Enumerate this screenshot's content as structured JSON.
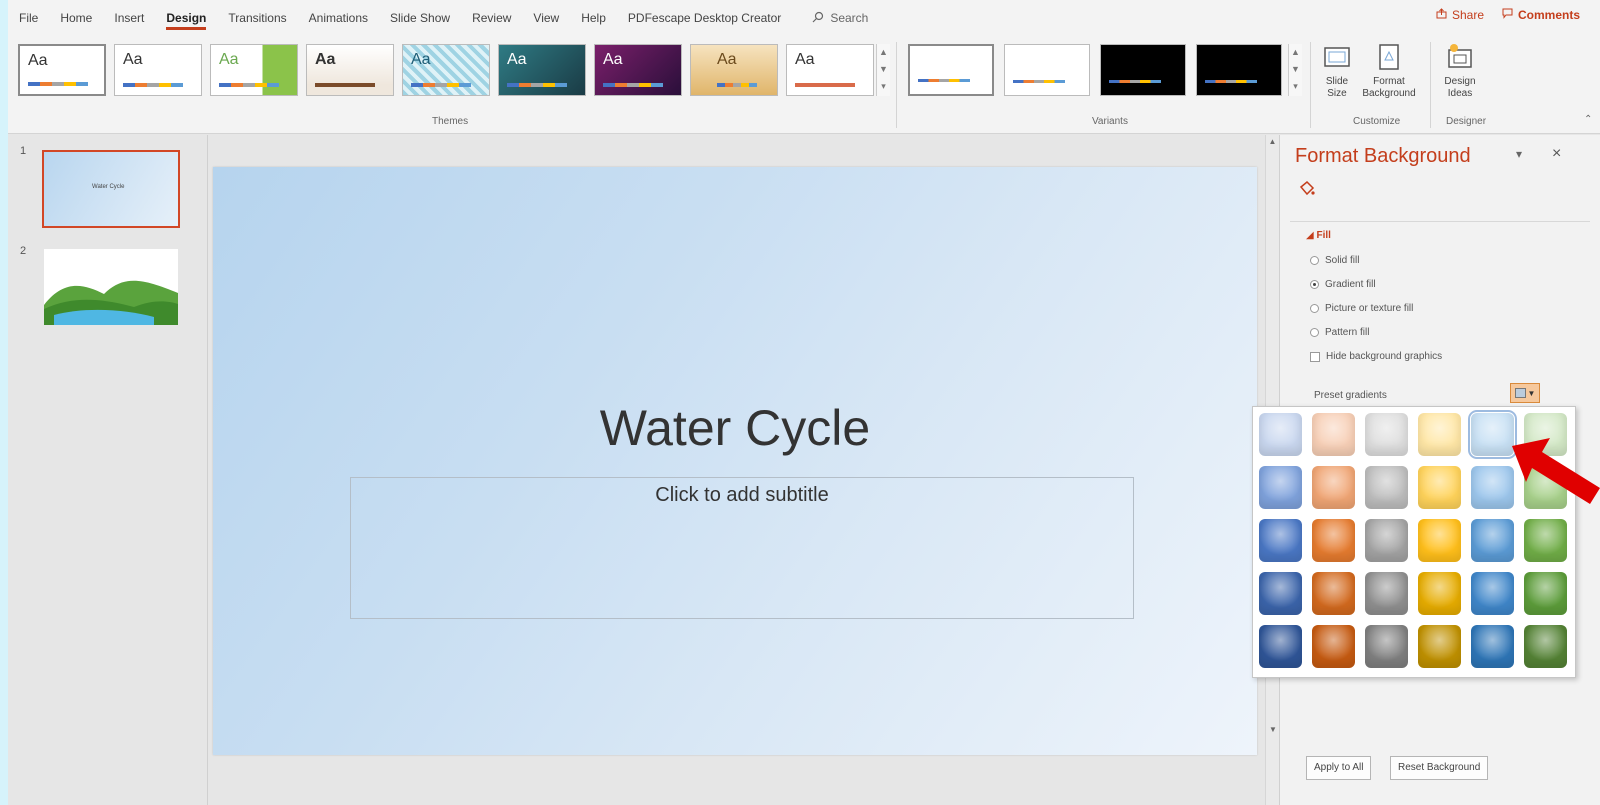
{
  "menu": {
    "tabs": [
      "File",
      "Home",
      "Insert",
      "Design",
      "Transitions",
      "Animations",
      "Slide Show",
      "Review",
      "View",
      "Help",
      "PDFescape Desktop Creator"
    ],
    "active_tab": "Design",
    "search_placeholder": "Search",
    "share_label": "Share",
    "comments_label": "Comments"
  },
  "ribbon": {
    "themes": [
      {
        "label": "Aa",
        "bg": "#ffffff",
        "fg": "#333333"
      },
      {
        "label": "Aa",
        "bg": "#ffffff",
        "fg": "#333333"
      },
      {
        "label": "Aa",
        "bg": "#eaf3e0",
        "fg": "#6aa84f"
      },
      {
        "label": "Aa",
        "bg": "#efe7dd",
        "fg": "#333333"
      },
      {
        "label": "Aa",
        "bg": "#bfe6ee",
        "fg": "#1f5e77"
      },
      {
        "label": "Aa",
        "bg": "#1e4b57",
        "fg": "#ffffff"
      },
      {
        "label": "Aa",
        "bg": "#4a1b4c",
        "fg": "#ffffff"
      },
      {
        "label": "Aa",
        "bg": "#f0d8a8",
        "fg": "#6b4a1c"
      },
      {
        "label": "Aa",
        "bg": "#ffffff",
        "fg": "#333333"
      }
    ],
    "themes_group_label": "Themes",
    "variants_group_label": "Variants",
    "slide_size_label_1": "Slide",
    "slide_size_label_2": "Size",
    "format_bg_label_1": "Format",
    "format_bg_label_2": "Background",
    "design_ideas_label_1": "Design",
    "design_ideas_label_2": "Ideas",
    "customize_group_label": "Customize",
    "designer_group_label": "Designer"
  },
  "thumbnails": {
    "slide1_number": "1",
    "slide1_caption": "Water Cycle",
    "slide2_number": "2"
  },
  "slide": {
    "title": "Water Cycle",
    "subtitle_placeholder": "Click to add subtitle"
  },
  "pane": {
    "title": "Format Background",
    "fill_header": "Fill",
    "options": [
      {
        "label": "Solid fill",
        "type": "radio",
        "checked": false
      },
      {
        "label": "Gradient fill",
        "type": "radio",
        "checked": true
      },
      {
        "label": "Picture or texture fill",
        "type": "radio",
        "checked": false
      },
      {
        "label": "Pattern fill",
        "type": "radio",
        "checked": false
      },
      {
        "label": "Hide background graphics",
        "type": "checkbox",
        "checked": false
      }
    ],
    "preset_gradients_label": "Preset gradients",
    "apply_all_label": "Apply to All",
    "reset_bg_label": "Reset Background"
  },
  "gradient_presets": {
    "columns": [
      "blue",
      "orange",
      "gray",
      "gold",
      "light-blue",
      "green"
    ],
    "rows": [
      [
        "#c9d7ef",
        "#f7cfb6",
        "#dedede",
        "#ffe7a6",
        "#c7e0f4",
        "#d3e8c6"
      ],
      [
        "#7fa2dc",
        "#f0a574",
        "#bdbdbd",
        "#ffd35a",
        "#9cc6ec",
        "#a7d08a"
      ],
      [
        "#4a77c4",
        "#e57b2f",
        "#a3a3a3",
        "#ffbf1a",
        "#5b9bd5",
        "#70ad47"
      ],
      [
        "#3b64aa",
        "#d2691e",
        "#8f8f8f",
        "#e6ac00",
        "#3f86c9",
        "#5c9c3a"
      ],
      [
        "#2f5597",
        "#c55a11",
        "#7f7f7f",
        "#bf9000",
        "#2e75b6",
        "#548235"
      ]
    ],
    "selected": "row1-col5"
  },
  "colors": {
    "accent": "#c43e1c",
    "arrow": "#e00000"
  }
}
